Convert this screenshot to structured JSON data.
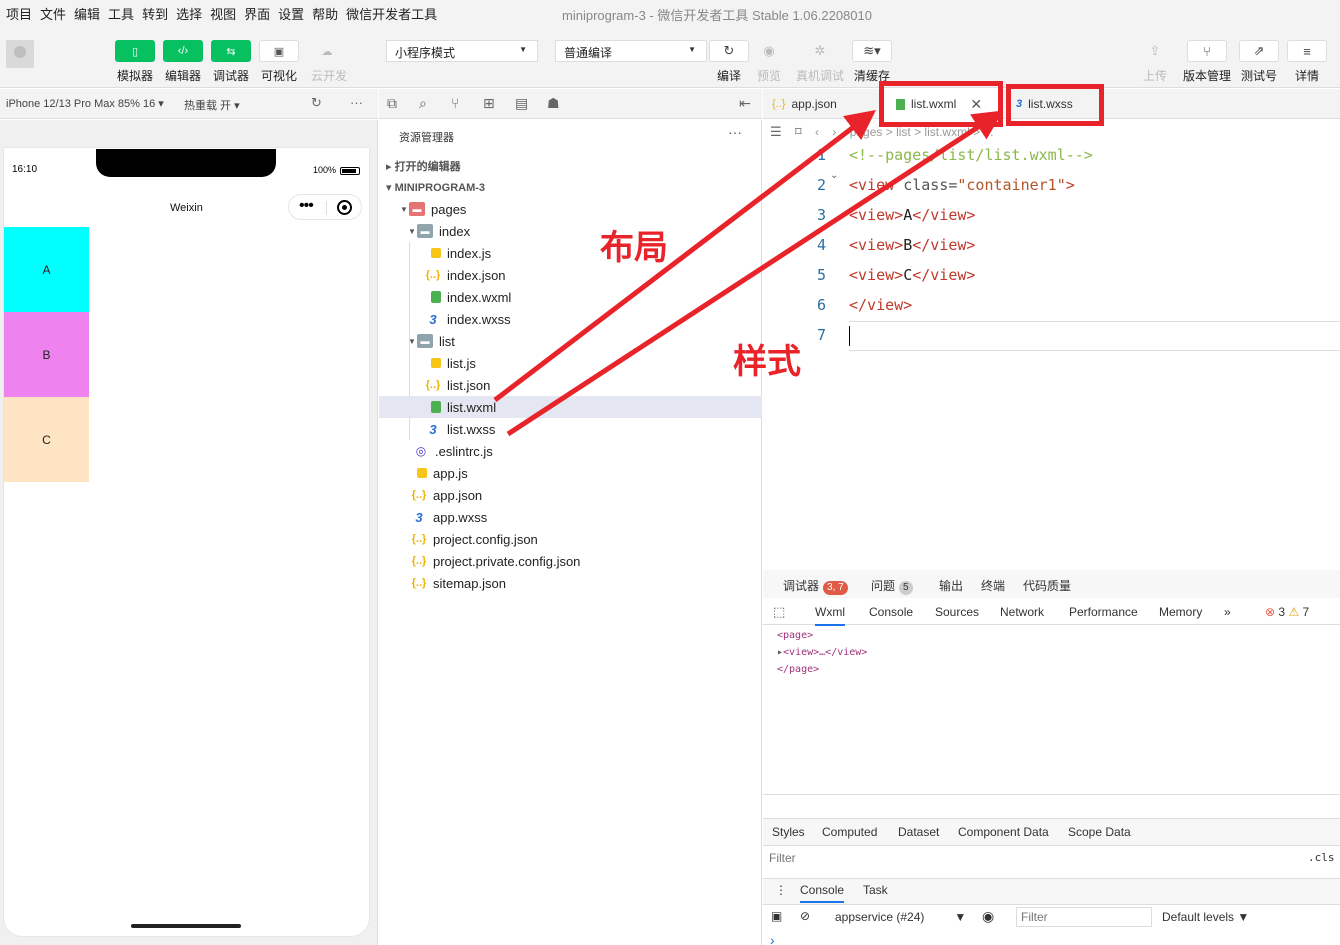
{
  "menubar": {
    "items": [
      "项目",
      "文件",
      "编辑",
      "工具",
      "转到",
      "选择",
      "视图",
      "界面",
      "设置",
      "帮助",
      "微信开发者工具"
    ],
    "window_title": "miniprogram-3 - 微信开发者工具 Stable 1.06.2208010"
  },
  "toolbar": {
    "simulator_label": "模拟器",
    "editor_label": "编辑器",
    "debugger_label": "调试器",
    "visual_label": "可视化",
    "cloud_label": "云开发",
    "mode_select": "小程序模式",
    "compile_select": "普通编译",
    "compile_label": "编译",
    "preview_label": "预览",
    "device_debug_label": "真机调试",
    "clear_cache_label": "清缓存",
    "upload_label": "上传",
    "version_label": "版本管理",
    "test_label": "测试号",
    "detail_label": "详情"
  },
  "simulator": {
    "device": "iPhone 12/13 Pro Max 85% 16 ▾",
    "hot_reload": "热重载 开 ▾",
    "time": "16:10",
    "battery": "100%",
    "nav_title": "Weixin",
    "blocks": [
      {
        "label": "A",
        "color": "#00ffff"
      },
      {
        "label": "B",
        "color": "#ee82ee"
      },
      {
        "label": "C",
        "color": "#ffe4c4"
      }
    ]
  },
  "explorer": {
    "title": "资源管理器",
    "open_editors": "打开的编辑器",
    "project": "MINIPROGRAM-3",
    "tree": {
      "pages": "pages",
      "index": "index",
      "index_js": "index.js",
      "index_json": "index.json",
      "index_wxml": "index.wxml",
      "index_wxss": "index.wxss",
      "list": "list",
      "list_js": "list.js",
      "list_json": "list.json",
      "list_wxml": "list.wxml",
      "list_wxss": "list.wxss",
      "eslintrc": ".eslintrc.js",
      "app_js": "app.js",
      "app_json": "app.json",
      "app_wxss": "app.wxss",
      "project_config": "project.config.json",
      "project_private": "project.private.config.json",
      "sitemap": "sitemap.json"
    }
  },
  "editor": {
    "tabs": [
      "app.json",
      "list.wxml",
      "list.wxss"
    ],
    "breadcrumb": "pages > list > list.wxml > ...",
    "line_numbers": [
      "1",
      "2",
      "3",
      "4",
      "5",
      "6",
      "7"
    ],
    "lines": {
      "l1": "<!--pages/list/list.wxml-->",
      "l2_tag": "<view ",
      "l2_attr": "class=",
      "l2_str": "\"container1\"",
      "l2_end": ">",
      "l3_open": "<view>",
      "l3_text": "A",
      "l3_close": "</view>",
      "l4_open": "<view>",
      "l4_text": "B",
      "l4_close": "</view>",
      "l5_open": "<view>",
      "l5_text": "C",
      "l5_close": "</view>",
      "l6": "</view>"
    }
  },
  "devtools": {
    "top_tabs": {
      "debugger": "调试器",
      "debugger_badge": "3, 7",
      "issues": "问题",
      "issues_badge": "5",
      "output": "输出",
      "terminal": "终端",
      "quality": "代码质量"
    },
    "panel_tabs": [
      "Wxml",
      "Console",
      "Sources",
      "Network",
      "Performance",
      "Memory"
    ],
    "more": "»",
    "errors": "3",
    "warnings": "7",
    "wxml_lines": [
      "<page>",
      "<view>…</view>",
      "</page>"
    ],
    "styles_tabs": [
      "Styles",
      "Computed",
      "Dataset",
      "Component Data",
      "Scope Data"
    ],
    "filter_placeholder": "Filter",
    "cls": ".cls",
    "console_tabs": [
      "Console",
      "Task"
    ],
    "context": "appservice (#24)",
    "console_filter": "Filter",
    "levels": "Default levels ▼",
    "prompt": "›"
  },
  "annotations": {
    "layout_label": "布局",
    "style_label": "样式",
    "color": "#e8232a"
  }
}
